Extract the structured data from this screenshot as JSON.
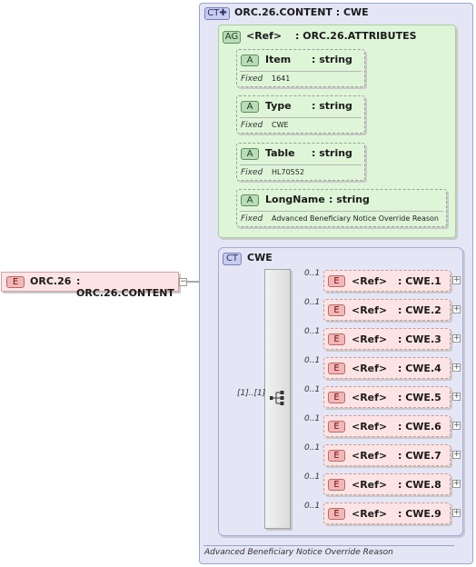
{
  "content_type": {
    "badge": "CT",
    "title": "ORC.26.CONTENT : CWE"
  },
  "attr_group": {
    "badge": "AG",
    "ref": "<Ref>",
    "name": ": ORC.26.ATTRIBUTES"
  },
  "attributes": [
    {
      "badge": "A",
      "name": "Item",
      "type": ": string",
      "fixed_label": "Fixed",
      "fixed_value": "1641"
    },
    {
      "badge": "A",
      "name": "Type",
      "type": ": string",
      "fixed_label": "Fixed",
      "fixed_value": "CWE"
    },
    {
      "badge": "A",
      "name": "Table",
      "type": ": string",
      "fixed_label": "Fixed",
      "fixed_value": "HL70552"
    },
    {
      "badge": "A",
      "name": "LongName",
      "type": ": string",
      "fixed_label": "Fixed",
      "fixed_value": "Advanced Beneficiary Notice Override Reason"
    }
  ],
  "root_element": {
    "badge": "E",
    "name": "ORC.26",
    "type": ": ORC.26.CONTENT"
  },
  "cwe_type": {
    "badge": "CT",
    "title": "CWE"
  },
  "sequence": {
    "occurrence": "[1]..[1]"
  },
  "elements": [
    {
      "badge": "E",
      "occurrence": "0..1",
      "ref": "<Ref>",
      "name": ": CWE.1"
    },
    {
      "badge": "E",
      "occurrence": "0..1",
      "ref": "<Ref>",
      "name": ": CWE.2"
    },
    {
      "badge": "E",
      "occurrence": "0..1",
      "ref": "<Ref>",
      "name": ": CWE.3"
    },
    {
      "badge": "E",
      "occurrence": "0..1",
      "ref": "<Ref>",
      "name": ": CWE.4"
    },
    {
      "badge": "E",
      "occurrence": "0..1",
      "ref": "<Ref>",
      "name": ": CWE.5"
    },
    {
      "badge": "E",
      "occurrence": "0..1",
      "ref": "<Ref>",
      "name": ": CWE.6"
    },
    {
      "badge": "E",
      "occurrence": "0..1",
      "ref": "<Ref>",
      "name": ": CWE.7"
    },
    {
      "badge": "E",
      "occurrence": "0..1",
      "ref": "<Ref>",
      "name": ": CWE.8"
    },
    {
      "badge": "E",
      "occurrence": "0..1",
      "ref": "<Ref>",
      "name": ": CWE.9"
    }
  ],
  "annotation": "Advanced Beneficiary Notice Override Reason",
  "colors": {
    "attr_bg": "#dff5d8",
    "type_bg": "#e4e6f6",
    "element_bg": "#fde4e4"
  },
  "icons": {
    "expand": "plus-icon",
    "sequence": "sequence-icon"
  }
}
